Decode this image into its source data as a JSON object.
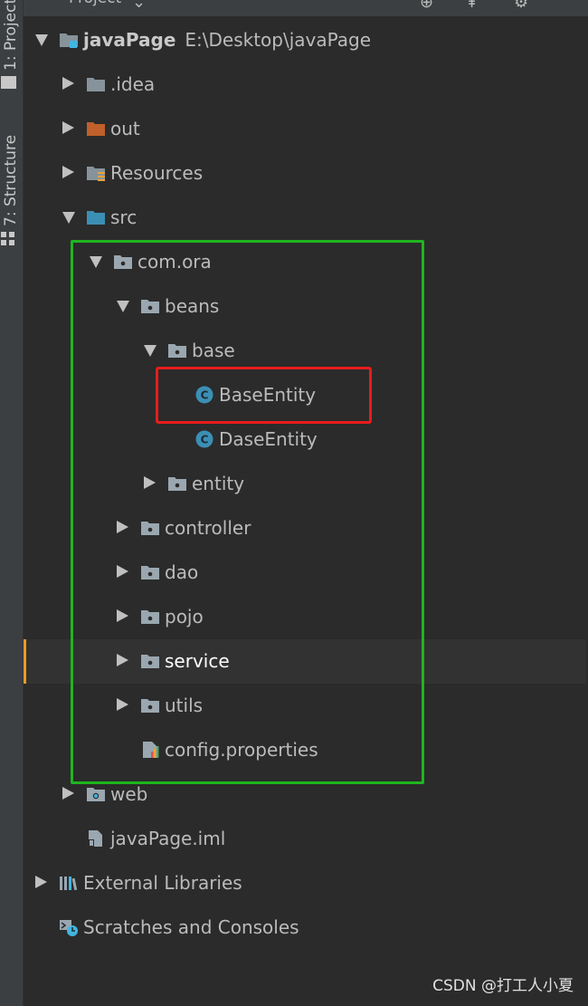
{
  "toolwindow": {
    "title": "Project",
    "side_tabs": [
      "1: Project",
      "7: Structure"
    ]
  },
  "tree": [
    {
      "label": "javaPage",
      "path": "E:\\Desktop\\javaPage",
      "level": 0,
      "state": "expanded",
      "icon": "module-folder-icon"
    },
    {
      "label": ".idea",
      "level": 1,
      "state": "collapsed",
      "icon": "folder-icon"
    },
    {
      "label": "out",
      "level": 1,
      "state": "collapsed",
      "icon": "excluded-folder-icon"
    },
    {
      "label": "Resources",
      "level": 1,
      "state": "collapsed",
      "icon": "resources-folder-icon"
    },
    {
      "label": "src",
      "level": 1,
      "state": "expanded",
      "icon": "source-folder-icon"
    },
    {
      "label": "com.ora",
      "level": 2,
      "state": "expanded",
      "icon": "package-icon"
    },
    {
      "label": "beans",
      "level": 3,
      "state": "expanded",
      "icon": "package-icon"
    },
    {
      "label": "base",
      "level": 4,
      "state": "expanded",
      "icon": "package-icon"
    },
    {
      "label": "BaseEntity",
      "level": 5,
      "state": "leaf",
      "icon": "class-icon"
    },
    {
      "label": "DaseEntity",
      "level": 5,
      "state": "leaf",
      "icon": "class-icon"
    },
    {
      "label": "entity",
      "level": 4,
      "state": "collapsed",
      "icon": "package-icon"
    },
    {
      "label": "controller",
      "level": 3,
      "state": "collapsed",
      "icon": "package-icon"
    },
    {
      "label": "dao",
      "level": 3,
      "state": "collapsed",
      "icon": "package-icon"
    },
    {
      "label": "pojo",
      "level": 3,
      "state": "collapsed",
      "icon": "package-icon"
    },
    {
      "label": "service",
      "level": 3,
      "state": "collapsed",
      "icon": "package-icon",
      "selected": true
    },
    {
      "label": "utils",
      "level": 3,
      "state": "collapsed",
      "icon": "package-icon"
    },
    {
      "label": "config.properties",
      "level": 3,
      "state": "leaf",
      "icon": "properties-file-icon"
    },
    {
      "label": "web",
      "level": 1,
      "state": "collapsed",
      "icon": "web-folder-icon"
    },
    {
      "label": "javaPage.iml",
      "level": 1,
      "state": "leaf",
      "icon": "iml-file-icon"
    },
    {
      "label": "External Libraries",
      "level": 0,
      "state": "collapsed",
      "icon": "libraries-icon"
    },
    {
      "label": "Scratches and Consoles",
      "level": 0,
      "state": "leaf",
      "icon": "scratches-icon"
    }
  ],
  "watermark": "CSDN @打工人小夏",
  "colors": {
    "background": "#2b2b2b",
    "highlight_green": "#1fb51f",
    "highlight_red": "#e81c1c",
    "selection_marker": "#e89d22",
    "class_icon": "#3b8fb5"
  }
}
